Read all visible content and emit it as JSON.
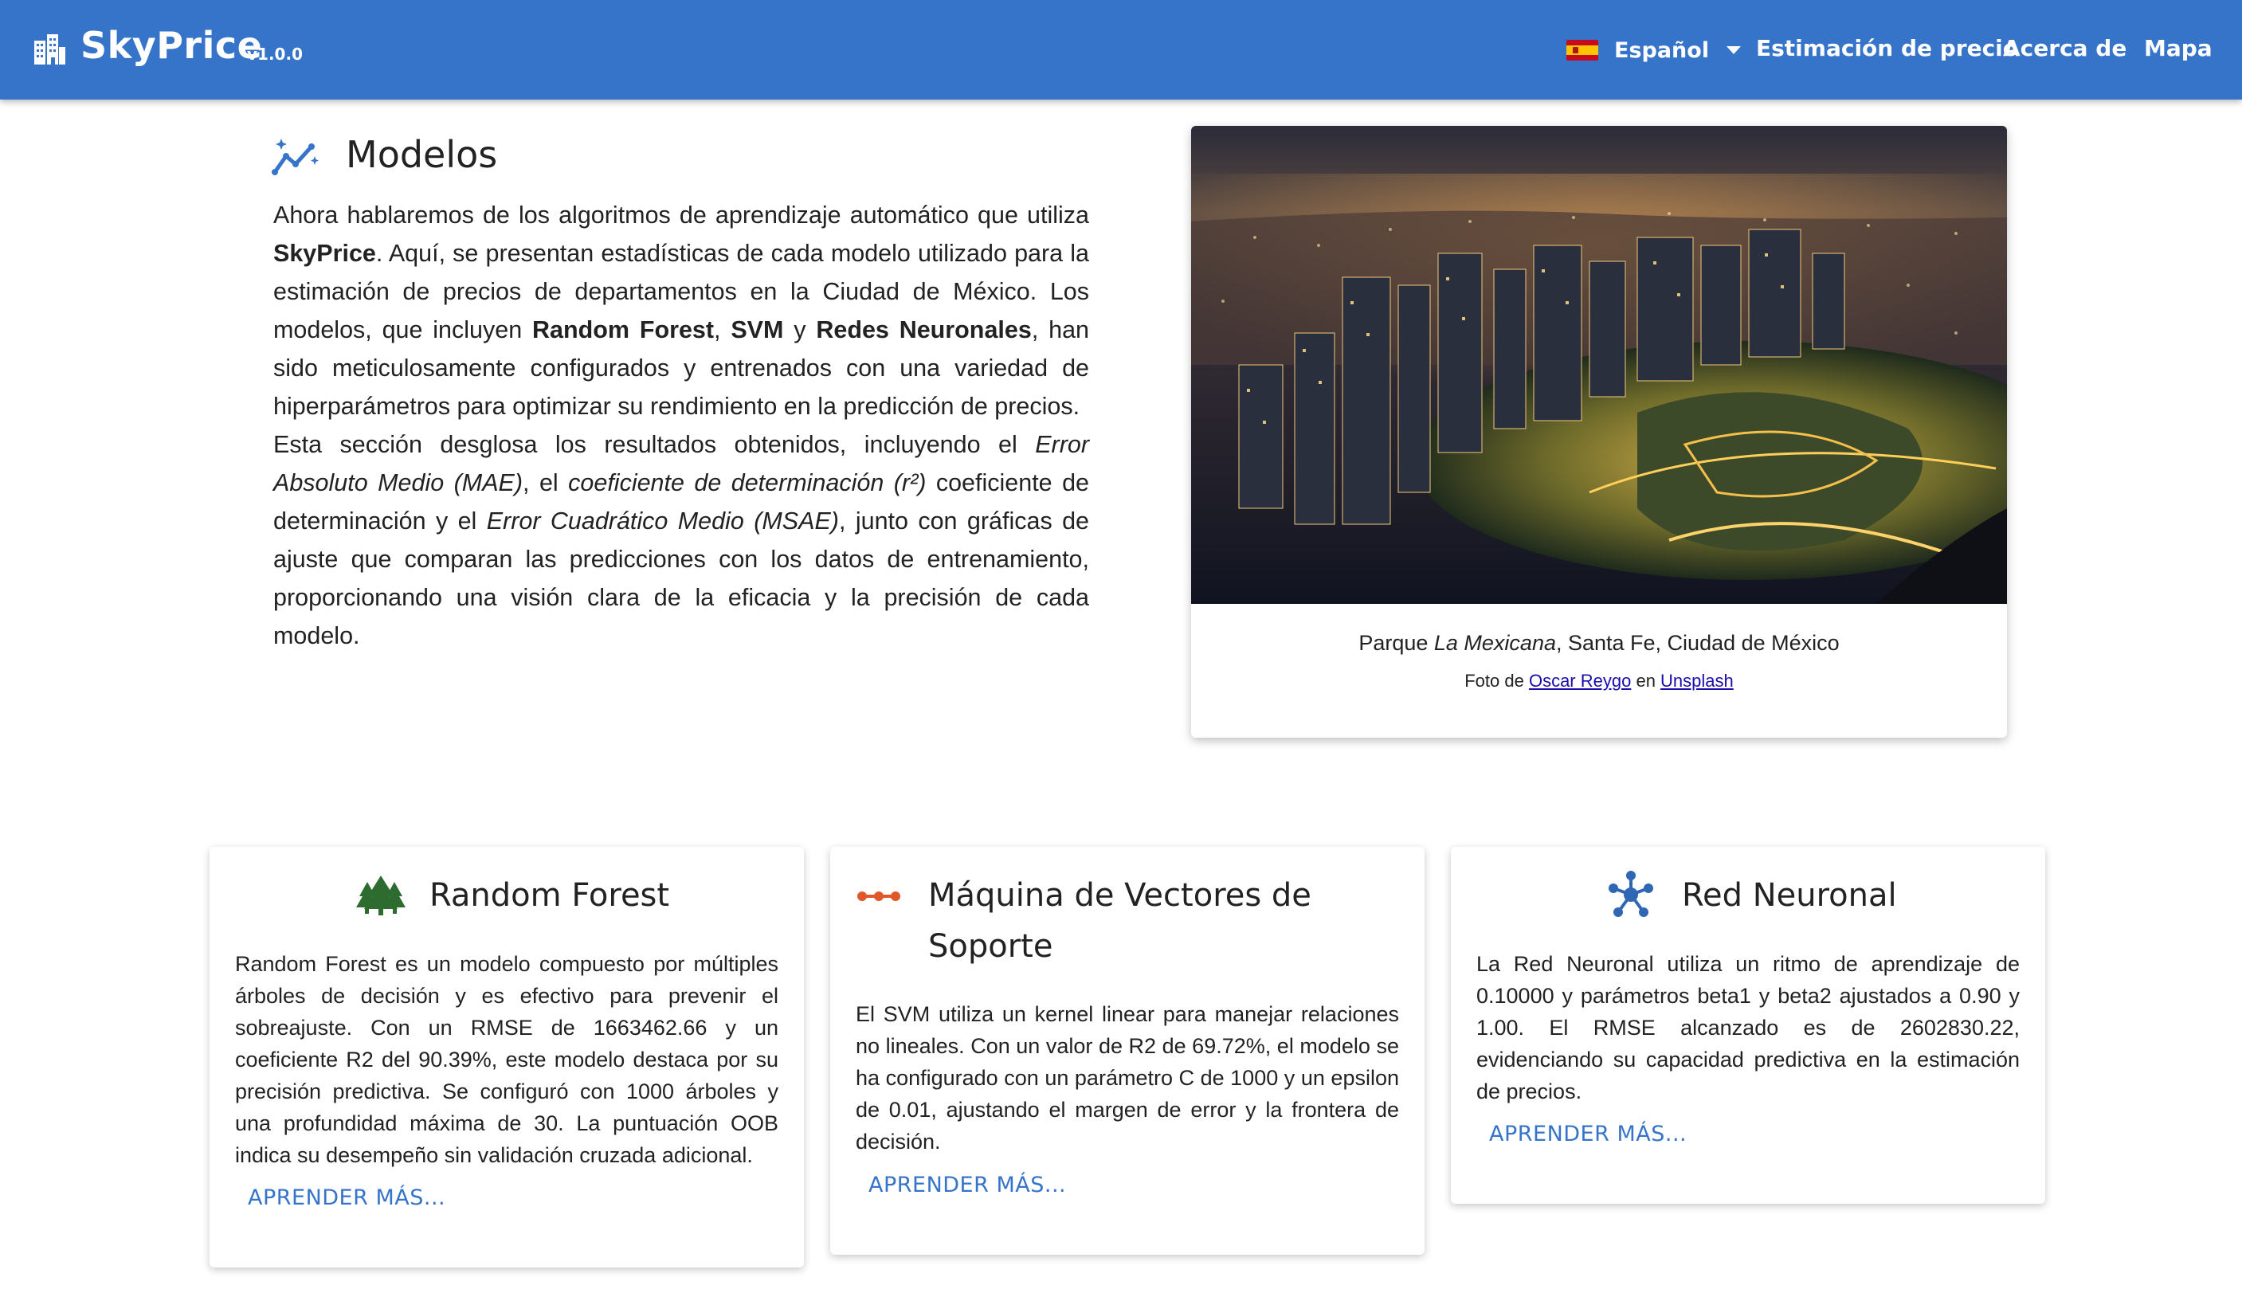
{
  "app": {
    "name": "SkyPrice",
    "version": "v1.0.0",
    "brand_icon": "city-icon"
  },
  "nav": {
    "language": "Español",
    "items": [
      "Estimación de precio",
      "Acerca de",
      "Mapa"
    ]
  },
  "intro": {
    "title": "Modelos",
    "icon": "chart-sparkle-icon",
    "p1_a": "Ahora hablaremos de los algoritmos de aprendizaje automático que utiliza ",
    "p1_b": "SkyPrice",
    "p1_c": ". Aquí, se presentan estadísticas de cada modelo utilizado para la estimación de precios de departamentos en la Ciudad de México. Los modelos, que incluyen ",
    "p1_d": "Random Forest",
    "p1_e": ", ",
    "p1_f": "SVM",
    "p1_g": " y ",
    "p1_h": "Redes Neuronales",
    "p1_i": ", han sido meticulosamente configurados y entrenados con una variedad de hiperparámetros para optimizar su rendimiento en la predicción de precios.",
    "p2_a": "Esta sección desglosa los resultados obtenidos, incluyendo el ",
    "p2_b": "Error Absoluto Medio (MAE)",
    "p2_c": ", el ",
    "p2_d": "coeficiente de determinación (r²)",
    "p2_e": " coeficiente de determinación y el ",
    "p2_f": "Error Cuadrático Medio (MSAE)",
    "p2_g": ", junto con gráficas de ajuste que comparan las predicciones con los datos de entrenamiento, proporcionando una visión clara de la eficacia y la precisión de cada modelo."
  },
  "photo": {
    "caption_a": "Parque ",
    "caption_b": "La Mexicana",
    "caption_c": ", Santa Fe, Ciudad de México",
    "credit_a": "Foto de ",
    "credit_author": "Oscar Reygo",
    "credit_b": " en ",
    "credit_site": "Unsplash"
  },
  "cards": [
    {
      "title": "Random Forest",
      "icon": "forest-icon",
      "color": "#2e6b2f",
      "text": "Random Forest es un modelo compuesto por múltiples árboles de decisión y es efectivo para prevenir el sobreajuste. Con un RMSE de 1663462.66 y un coeficiente R2 del 90.39%, este modelo destaca por su precisión predictiva. Se configuró con 1000 árboles y una profundidad máxima de 30. La puntuación OOB indica su desempeño sin validación cruzada adicional.",
      "link": "APRENDER MÁS..."
    },
    {
      "title": "Máquina de Vectores de Soporte",
      "icon": "vector-dots-icon",
      "color": "#e0582a",
      "text": "El SVM utiliza un kernel linear para manejar relaciones no lineales. Con un valor de R2 de 69.72%, el modelo se ha configurado con un parámetro C de 1000 y un epsilon de 0.01, ajustando el margen de error y la frontera de decisión.",
      "link": "APRENDER MÁS..."
    },
    {
      "title": "Red Neuronal",
      "icon": "neural-network-icon",
      "color": "#2f67b5",
      "text": "La Red Neuronal utiliza un ritmo de aprendizaje de 0.10000 y parámetros beta1 y beta2 ajustados a 0.90 y 1.00. El RMSE alcanzado es de 2602830.22, evidenciando su capacidad predictiva en la estimación de precios.",
      "link": "APRENDER MÁS..."
    }
  ]
}
